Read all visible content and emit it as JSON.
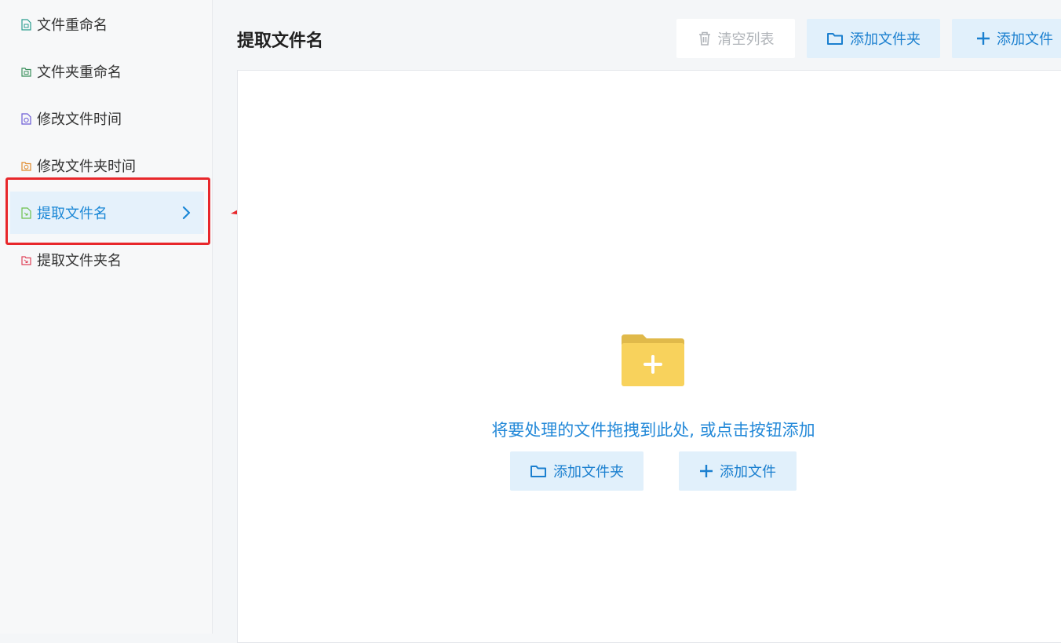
{
  "sidebar": {
    "items": [
      {
        "label": "文件重命名",
        "icon": "file-rename-icon",
        "color": "#2a9d8f"
      },
      {
        "label": "文件夹重命名",
        "icon": "folder-rename-icon",
        "color": "#3a8f5c"
      },
      {
        "label": "修改文件时间",
        "icon": "file-time-icon",
        "color": "#6b5bd6"
      },
      {
        "label": "修改文件夹时间",
        "icon": "folder-time-icon",
        "color": "#e08a2c"
      },
      {
        "label": "提取文件名",
        "icon": "extract-filename-icon",
        "color": "#6cc04a",
        "active": true
      },
      {
        "label": "提取文件夹名",
        "icon": "extract-foldername-icon",
        "color": "#e0435a"
      }
    ]
  },
  "header": {
    "title": "提取文件名"
  },
  "toolbar": {
    "clear_label": "清空列表",
    "add_folder_label": "添加文件夹",
    "add_file_label": "添加文件"
  },
  "dropzone": {
    "hint": "将要处理的文件拖拽到此处, 或点击按钮添加",
    "add_folder_label": "添加文件夹",
    "add_file_label": "添加文件"
  },
  "colors": {
    "accent": "#1a87d6",
    "highlight": "#e8272b",
    "folder": "#f8d25c"
  }
}
